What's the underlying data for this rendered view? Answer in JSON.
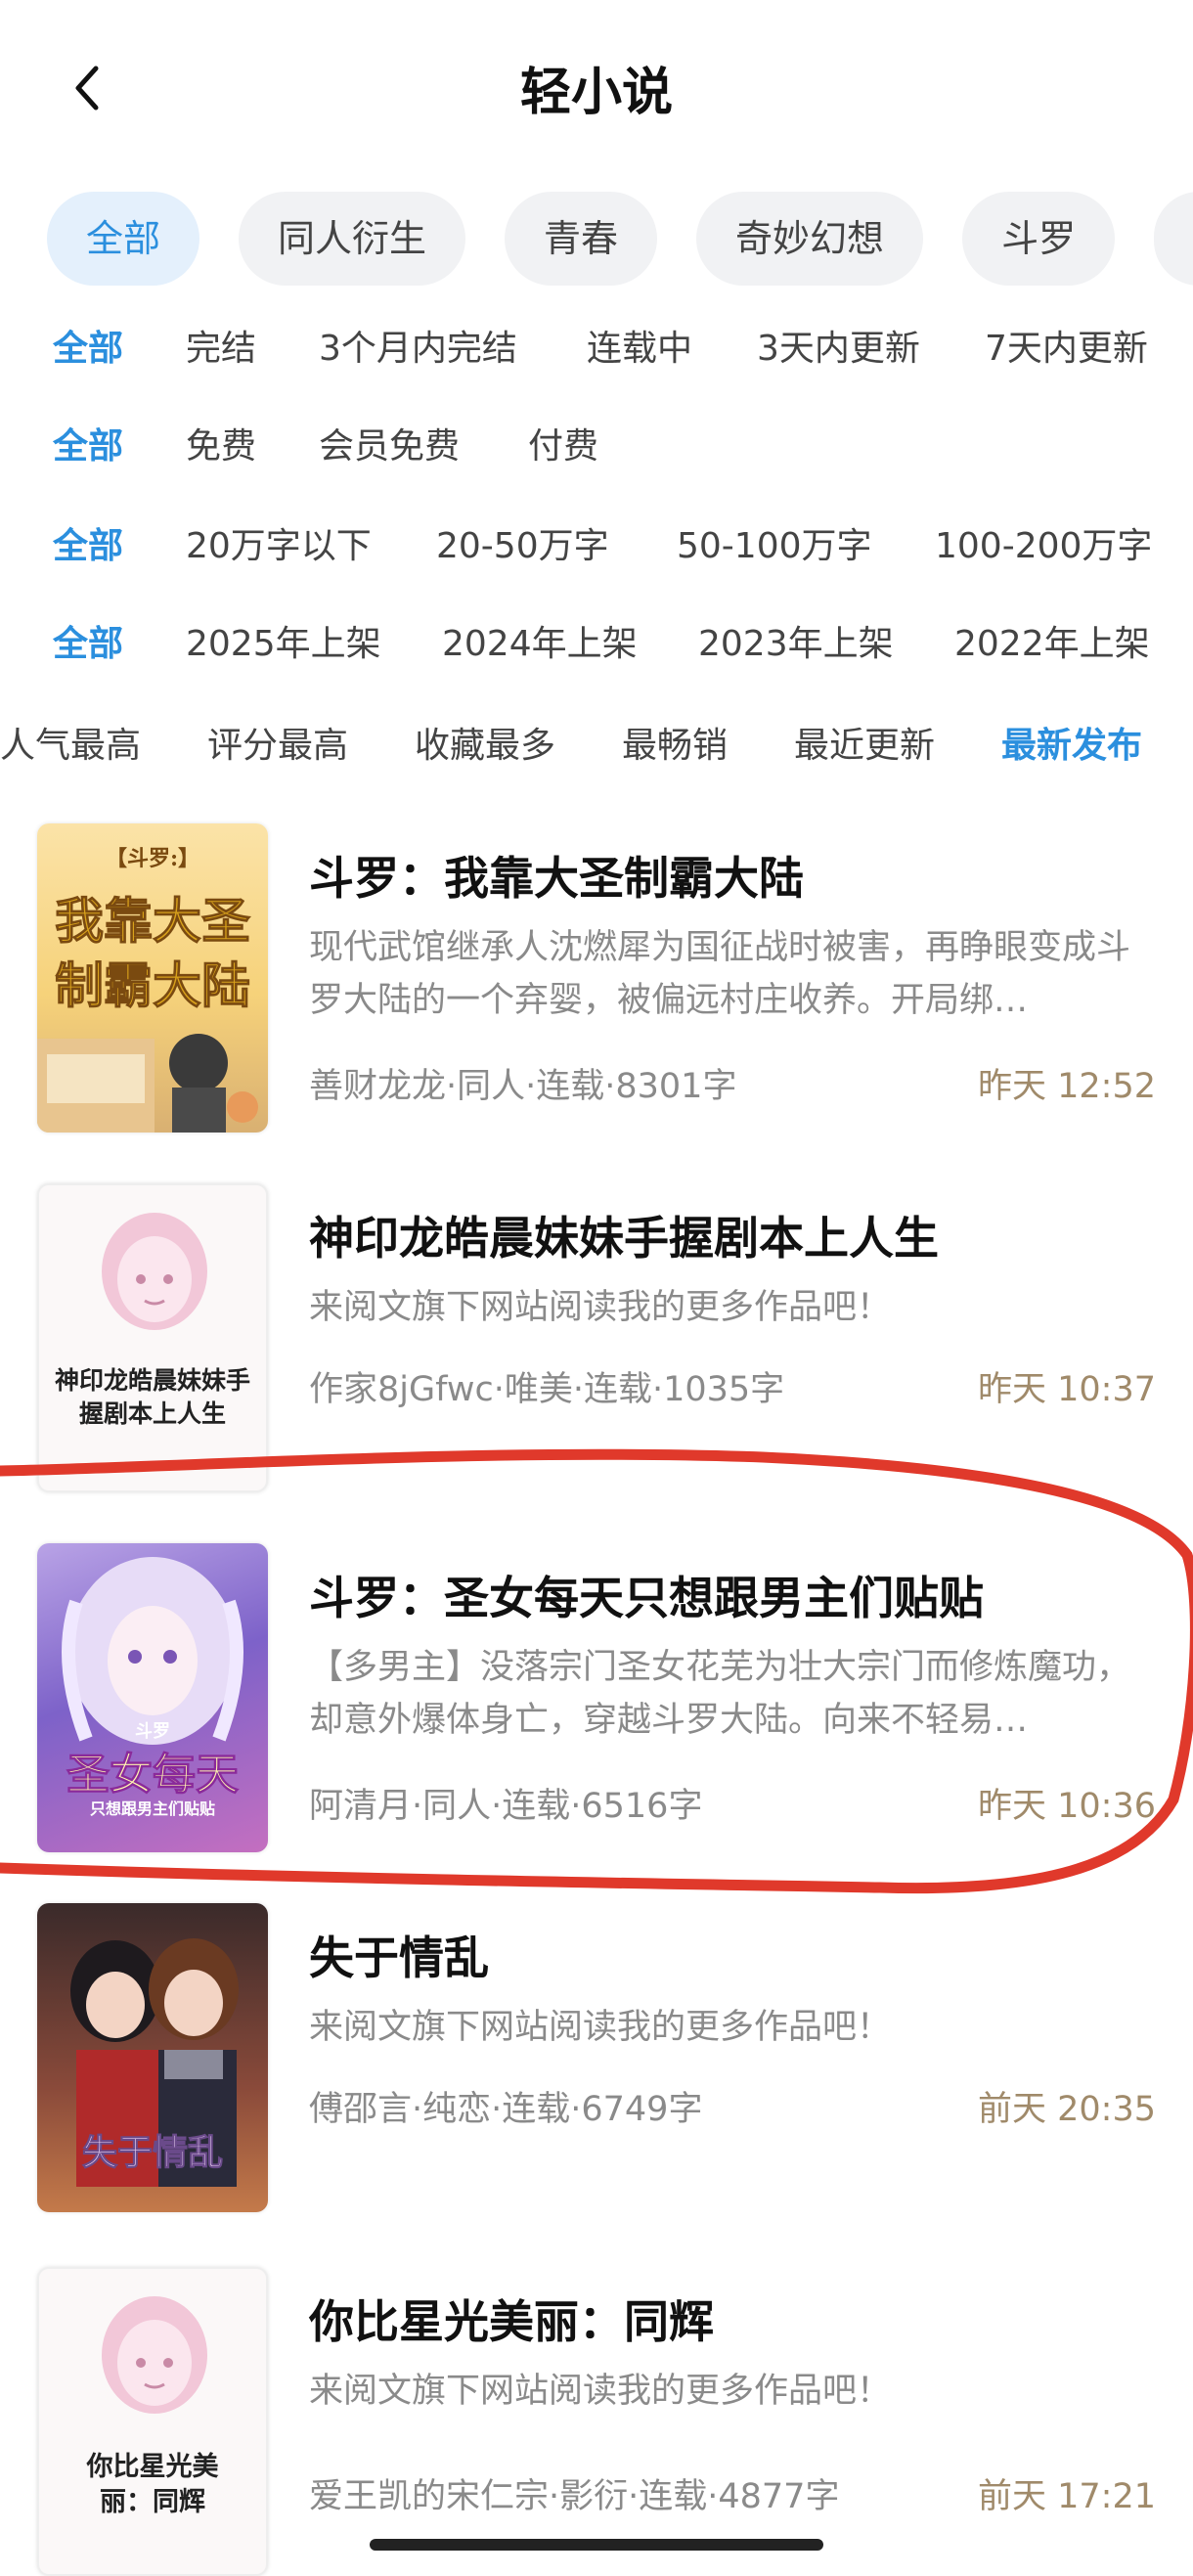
{
  "header": {
    "title": "轻小说"
  },
  "category_pills": [
    "全部",
    "同人衍生",
    "青春",
    "奇妙幻想",
    "斗罗"
  ],
  "filter_rows": [
    [
      "全部",
      "完结",
      "3个月内完结",
      "连载中",
      "3天内更新",
      "7天内更新"
    ],
    [
      "全部",
      "免费",
      "会员免费",
      "付费"
    ],
    [
      "全部",
      "20万字以下",
      "20-50万字",
      "50-100万字",
      "100-200万字"
    ],
    [
      "全部",
      "2025年上架",
      "2024年上架",
      "2023年上架",
      "2022年上架"
    ]
  ],
  "sort_tabs": [
    "人气最高",
    "评分最高",
    "收藏最多",
    "最畅销",
    "最近更新",
    "最新发布"
  ],
  "active_sort": "最新发布",
  "books": [
    {
      "title": "斗罗：我靠大圣制霸大陆",
      "desc": "现代武馆继承人沈燃犀为国征战时被害，再睁眼变成斗罗大陆的一个弃婴，被偏远村庄收养。开局绑…",
      "meta": "善财龙龙·同人·连载·8301字",
      "time": "昨天 12:52",
      "cover_text": [
        "【斗罗:】",
        "我靠大圣",
        "制霸大陆"
      ]
    },
    {
      "title": "神印龙皓晨妹妹手握剧本上人生",
      "desc": "来阅文旗下网站阅读我的更多作品吧！",
      "meta": "作家8jGfwc·唯美·连载·1035字",
      "time": "昨天 10:37",
      "cover_text": [
        "神印龙皓晨妹妹手",
        "握剧本上人生"
      ]
    },
    {
      "title": "斗罗：圣女每天只想跟男主们贴贴",
      "desc": "【多男主】没落宗门圣女花芜为壮大宗门而修炼魔功，却意外爆体身亡，穿越斗罗大陆。向来不轻易…",
      "meta": "阿清月·同人·连载·6516字",
      "time": "昨天 10:36",
      "cover_text": [
        "斗罗",
        "圣女每天",
        "只想跟男主们贴贴"
      ]
    },
    {
      "title": "失于情乱",
      "desc": "来阅文旗下网站阅读我的更多作品吧！",
      "meta": "傅邵言·纯恋·连载·6749字",
      "time": "前天 20:35",
      "cover_text": [
        "失于情乱"
      ]
    },
    {
      "title": "你比星光美丽：同辉",
      "desc": "来阅文旗下网站阅读我的更多作品吧！",
      "meta": "爱王凯的宋仁宗·影衍·连载·4877字",
      "time": "前天 17:21",
      "cover_text": [
        "你比星光美",
        "丽：同辉"
      ]
    }
  ],
  "colors": {
    "accent": "#2b8fde",
    "time": "#a08a6a",
    "annotation": "#e0392b"
  }
}
